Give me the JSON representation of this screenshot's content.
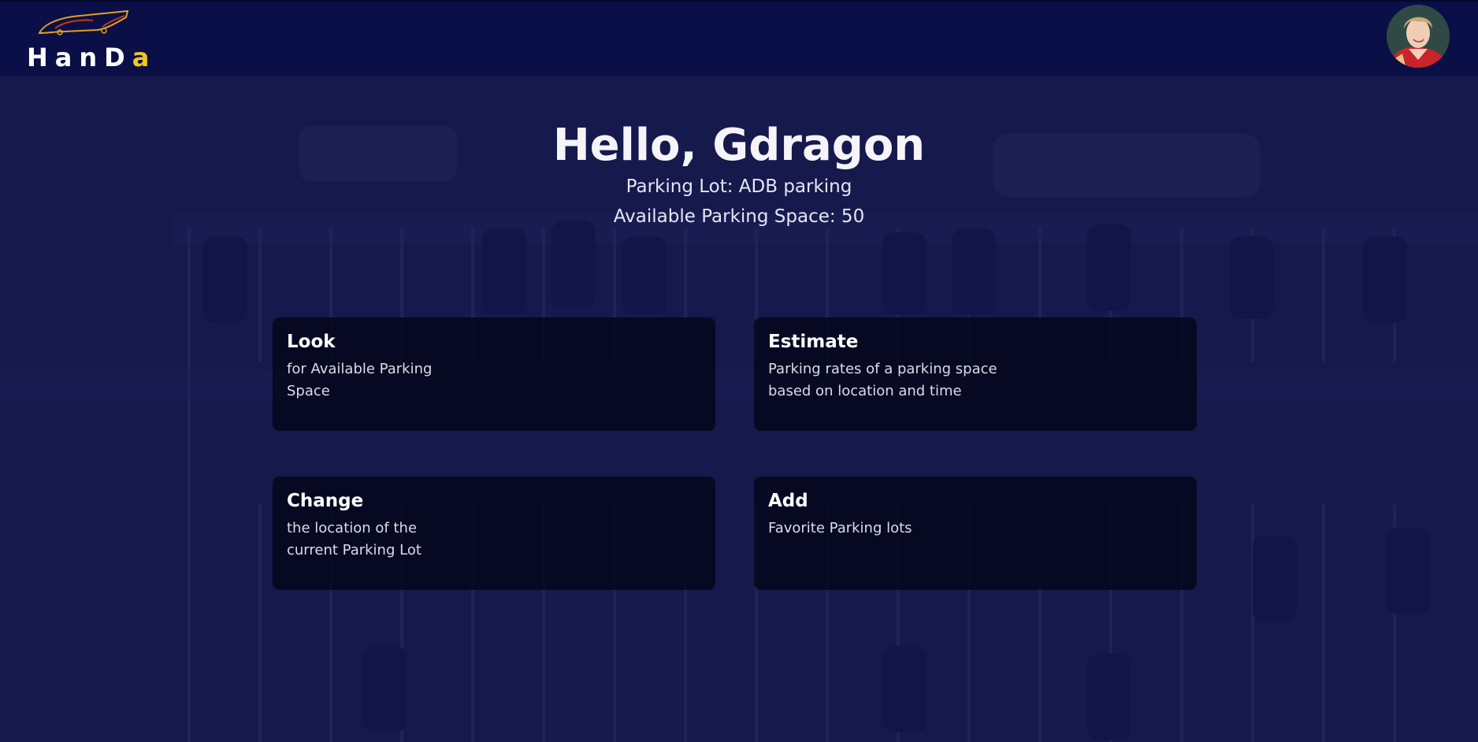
{
  "brand": {
    "logo_text_white": "HanD",
    "logo_text_accent": "a",
    "accent_color": "#f2c81b",
    "icon": "sports-car-outline-icon"
  },
  "header": {
    "avatar": "user-avatar-photo"
  },
  "welcome": {
    "greeting": "Hello, Gdragon",
    "parking_lot": "Parking Lot: ADB parking",
    "available_space": "Available Parking Space: 50"
  },
  "cards": [
    {
      "title": "Look",
      "desc_lines": [
        "for Available Parking",
        "Space"
      ]
    },
    {
      "title": "Estimate",
      "desc_lines": [
        "Parking rates of a parking space",
        "based on location and time"
      ]
    },
    {
      "title": "Change",
      "desc_lines": [
        "the location of the",
        "current Parking Lot"
      ]
    },
    {
      "title": "Add",
      "desc_lines": [
        "Favorite Parking lots"
      ]
    }
  ],
  "colors": {
    "header_bg": "#0b0f47",
    "page_bg": "#12164a",
    "card_bg": "#06071c"
  }
}
